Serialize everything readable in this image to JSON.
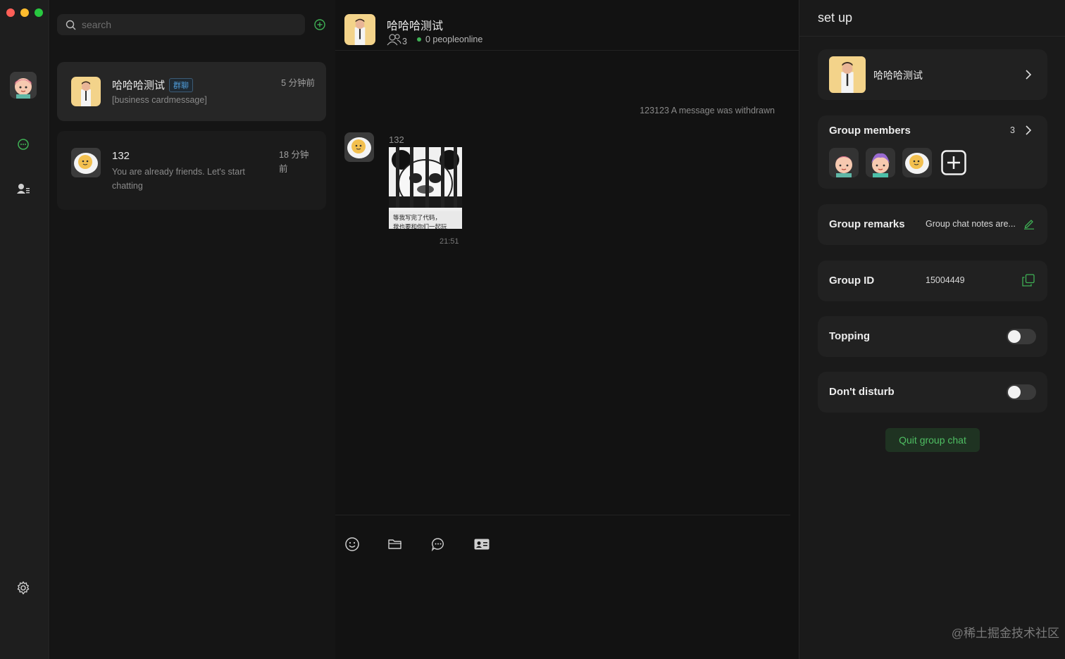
{
  "window": {
    "controls": [
      "close",
      "minimize",
      "zoom"
    ]
  },
  "rail": {
    "avatar": "user-avatar-girl",
    "items": [
      {
        "name": "chat-icon",
        "active": true
      },
      {
        "name": "contacts-icon",
        "active": false
      }
    ],
    "bottom": "settings-icon"
  },
  "search": {
    "placeholder": "search"
  },
  "conversations": [
    {
      "title": "哈哈哈测试",
      "tag": "群聊",
      "preview": "[business cardmessage]",
      "time": "5 分钟前"
    },
    {
      "title": "132",
      "preview_line1": "You are already friends. Let's start",
      "preview_line2": "chatting",
      "time_line1": "18 分钟",
      "time_line2": "前"
    }
  ],
  "chat": {
    "title": "哈哈哈测试",
    "member_count": "3",
    "online": "0 peopleonline",
    "system_message": "123123 A message was withdrawn",
    "message": {
      "sender": "132",
      "sticker_caption_line1": "等我写完了代码，",
      "sticker_caption_line2": "我也要和你们一起玩",
      "time": "21:51"
    },
    "toolbar": [
      "emoji-icon",
      "folder-icon",
      "message-icon",
      "business-card-icon"
    ]
  },
  "settings": {
    "title": "set up",
    "group_name": "哈哈哈测试",
    "members_label": "Group members",
    "members_count": "3",
    "remarks_label": "Group remarks",
    "remarks_value": "Group chat notes are...",
    "id_label": "Group ID",
    "id_value": "15004449",
    "topping_label": "Topping",
    "topping_on": false,
    "dnd_label": "Don't disturb",
    "dnd_on": false,
    "quit_label": "Quit group chat"
  },
  "watermark": "@稀土掘金技术社区",
  "colors": {
    "accent": "#4fbf63",
    "online": "#3fb155",
    "tag": "#4e9bd8"
  }
}
